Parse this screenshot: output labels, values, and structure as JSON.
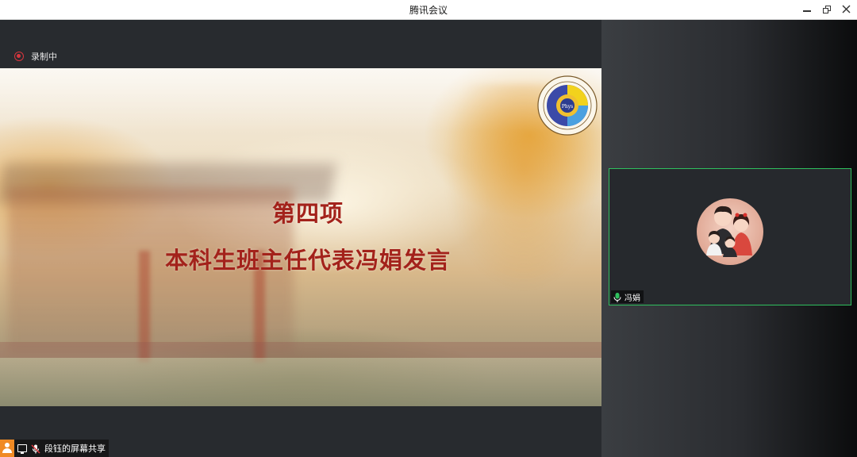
{
  "window": {
    "title": "腾讯会议"
  },
  "recording": {
    "label": "录制中"
  },
  "slide": {
    "title": "第四项",
    "subtitle": "本科生班主任代表冯娟发言"
  },
  "share_status": {
    "label": "段钰的屏幕共享"
  },
  "participant": {
    "name": "冯娟"
  },
  "colors": {
    "accent_green": "#2fbf5e",
    "recording_red": "#d9363e",
    "slide_text_red": "#a3221b"
  },
  "icons": {
    "minimize": "minimize-icon",
    "restore": "restore-icon",
    "close": "close-icon",
    "recording": "record-icon",
    "person": "person-icon",
    "screen": "screen-share-icon",
    "mic_muted": "mic-muted-icon",
    "mic_on": "mic-icon"
  }
}
